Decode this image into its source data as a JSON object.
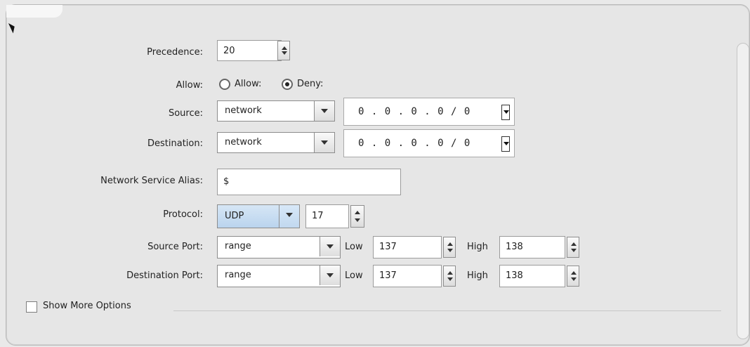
{
  "labels": {
    "precedence": "Precedence:",
    "allow": "Allow:",
    "source": "Source:",
    "destination": "Destination:",
    "network_service_alias": "Network Service Alias:",
    "protocol": "Protocol:",
    "source_port": "Source Port:",
    "destination_port": "Destination Port:"
  },
  "precedence": {
    "value": "20"
  },
  "allow": {
    "allow_text": "Allow:",
    "deny_text": "Deny:",
    "selected": "Deny"
  },
  "source": {
    "type": "network",
    "ip": "0 . 0 . 0 . 0 / 0"
  },
  "destination": {
    "type": "network",
    "ip": "0 . 0 . 0 . 0 / 0"
  },
  "network_service_alias": {
    "value": "$"
  },
  "protocol": {
    "type": "UDP",
    "number": "17"
  },
  "source_port": {
    "mode": "range",
    "low_label": "Low",
    "low_value": "137",
    "high_label": "High",
    "high_value": "138"
  },
  "destination_port": {
    "mode": "range",
    "low_label": "Low",
    "low_value": "137",
    "high_label": "High",
    "high_value": "138"
  },
  "options": {
    "show_more_options": "Show More Options"
  }
}
